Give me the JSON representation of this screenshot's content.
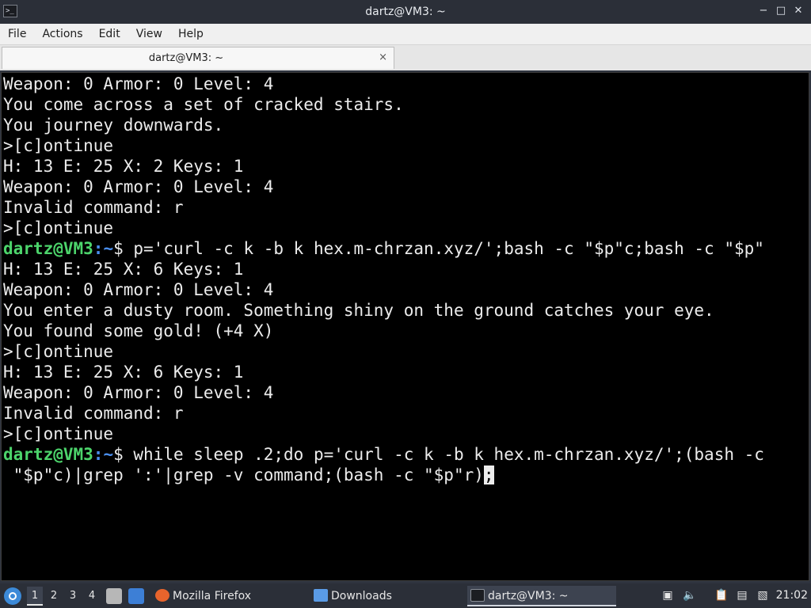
{
  "window": {
    "title": "dartz@VM3: ~",
    "icon": "terminal-icon",
    "controls": [
      "minimize",
      "maximize",
      "close"
    ]
  },
  "menu": {
    "items": [
      "File",
      "Actions",
      "Edit",
      "View",
      "Help"
    ]
  },
  "tab": {
    "label": "dartz@VM3: ~",
    "close": "×"
  },
  "terminal": {
    "colors": {
      "background": "#000000",
      "text": "#ececec",
      "user": "#4cd46b",
      "path": "#4a8ff0"
    },
    "lines": [
      {
        "text": "Weapon: 0 Armor: 0 Level: 4"
      },
      {
        "text": "You come across a set of cracked stairs."
      },
      {
        "text": "You journey downwards."
      },
      {
        "text": ">[c]ontinue"
      },
      {
        "text": "H: 13 E: 25 X: 2 Keys: 1"
      },
      {
        "text": "Weapon: 0 Armor: 0 Level: 4"
      },
      {
        "text": "Invalid command: r"
      },
      {
        "text": ">[c]ontinue"
      },
      {
        "user": "dartz@VM3",
        "path": "~",
        "text": "$ p='curl -c k -b k hex.m-chrzan.xyz/';bash -c \"$p\"c;bash -c \"$p\""
      },
      {
        "text": "H: 13 E: 25 X: 6 Keys: 1"
      },
      {
        "text": "Weapon: 0 Armor: 0 Level: 4"
      },
      {
        "text": "You enter a dusty room. Something shiny on the ground catches your eye."
      },
      {
        "text": "You found some gold! (+4 X)"
      },
      {
        "text": ">[c]ontinue"
      },
      {
        "text": "H: 13 E: 25 X: 6 Keys: 1"
      },
      {
        "text": "Weapon: 0 Armor: 0 Level: 4"
      },
      {
        "text": "Invalid command: r"
      },
      {
        "text": ">[c]ontinue"
      },
      {
        "user": "dartz@VM3",
        "path": "~",
        "text": "$ while sleep .2;do p='curl -c k -b k hex.m-chrzan.xyz/';(bash -c"
      },
      {
        "text": " \"$p\"c)|grep ':'|grep -v command;(bash -c \"$p\"r)",
        "cursor": ";"
      }
    ]
  },
  "taskbar": {
    "workspaces": [
      "1",
      "2",
      "3",
      "4"
    ],
    "active_workspace": "1",
    "tasks": [
      {
        "label": "Mozilla Firefox",
        "icon": "firefox-icon"
      },
      {
        "label": "Downloads",
        "icon": "folder-icon"
      },
      {
        "label": "dartz@VM3: ~",
        "icon": "terminal-icon",
        "active": true
      }
    ],
    "clock": "21:02"
  }
}
